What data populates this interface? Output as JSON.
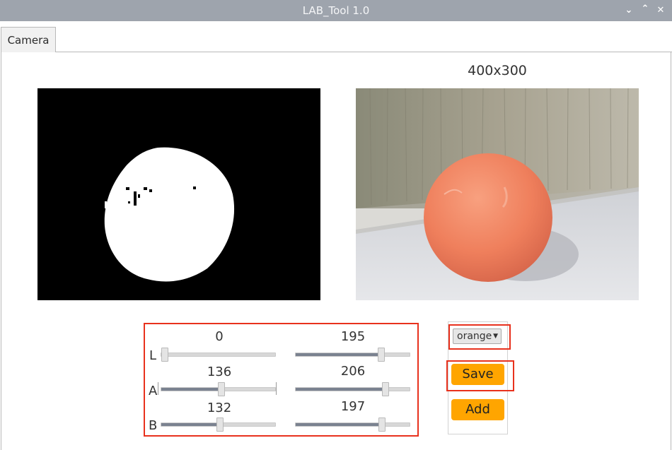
{
  "window": {
    "title": "LAB_Tool 1.0"
  },
  "tabs": [
    {
      "label": "Camera"
    }
  ],
  "resolution_label": "400x300",
  "sliders": {
    "L": {
      "axis": "L",
      "min_value": "0",
      "max_value": "195",
      "min_fraction": 0.0,
      "max_fraction": 0.765
    },
    "A": {
      "axis": "A",
      "min_value": "136",
      "max_value": "206",
      "min_fraction": 0.533,
      "max_fraction": 0.808
    },
    "B": {
      "axis": "B",
      "min_value": "132",
      "max_value": "197",
      "min_fraction": 0.518,
      "max_fraction": 0.773
    }
  },
  "color_select": {
    "selected": "orange"
  },
  "buttons": {
    "save": "Save",
    "add": "Add"
  },
  "colors": {
    "highlight": "#e8311d",
    "button": "#ffa500",
    "ball": "#f2835f"
  },
  "icons": {
    "minimize": "chevron-down-icon",
    "maximize": "chevron-up-icon",
    "close": "close-icon",
    "dropdown": "caret-down-icon"
  }
}
